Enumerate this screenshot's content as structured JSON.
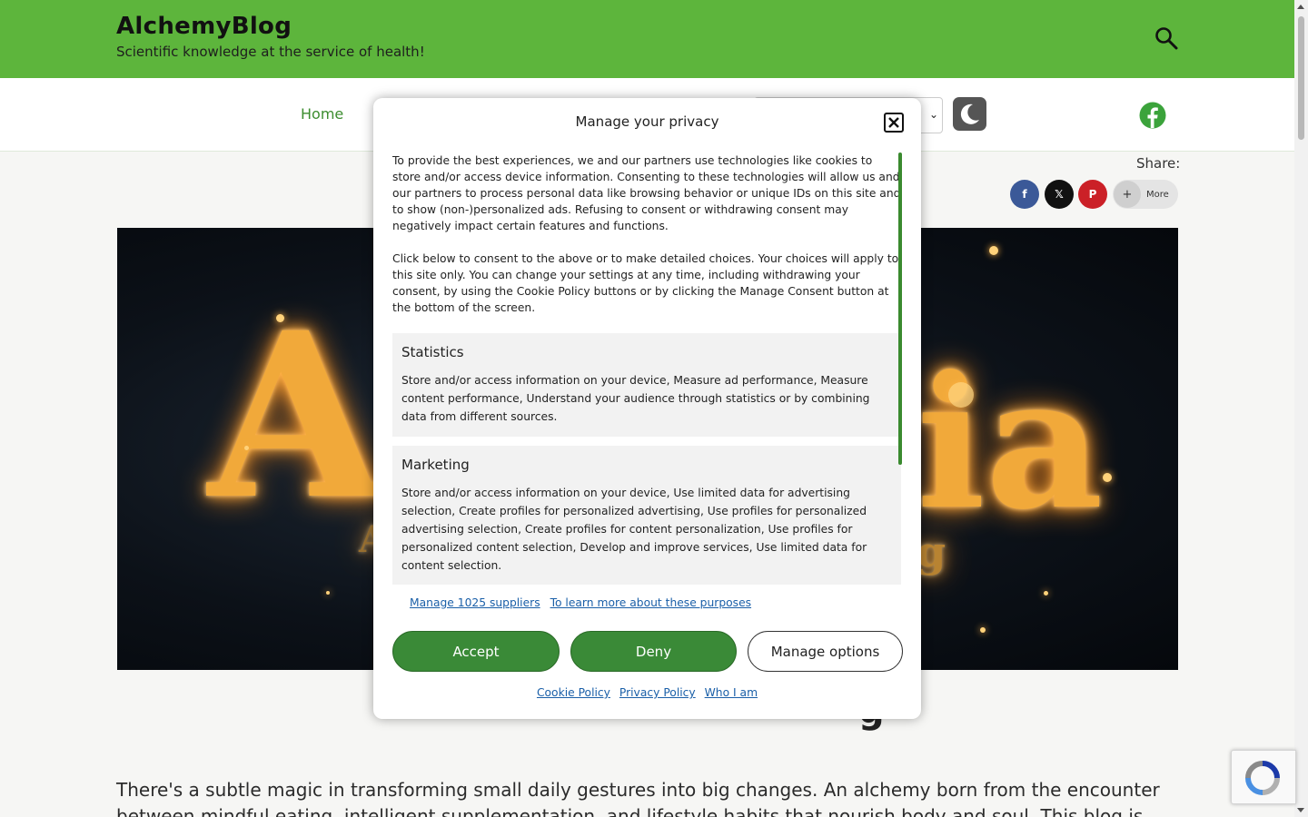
{
  "header": {
    "site_title": "AlchemyBlog",
    "tagline": "Scientific knowledge at the service of health!",
    "search_icon": "search-icon",
    "background_color": "#5db53c"
  },
  "nav": {
    "home_label": "Home",
    "language_select_icon": "chevron-down-icon",
    "dark_mode_icon": "moon-icon",
    "social_icon": "facebook-icon"
  },
  "share": {
    "label": "Share:",
    "facebook": "f",
    "x": "𝕏",
    "pinterest": "P",
    "more_label": "More",
    "more_plus": "+"
  },
  "hero": {
    "letters": [
      "A",
      "ia",
      "A",
      "g"
    ]
  },
  "article": {
    "heading_peek": "g",
    "intro": "There's a subtle magic in transforming small daily gestures into big changes. An alchemy born from the encounter between mindful eating, intelligent supplementation, and lifestyle habits that nourish body and soul. This blog is"
  },
  "consent_modal": {
    "title": "Manage your privacy",
    "close_label": "✕",
    "paragraphs": [
      "To provide the best experiences, we and our partners use technologies like cookies to store and/or access device information. Consenting to these technologies will allow us and our partners to process personal data like browsing behavior or unique IDs on this site and to show (non-)personalized ads. Refusing to consent or withdrawing consent may negatively impact certain features and functions.",
      "Click below to consent to the above or to make detailed choices. Your choices will apply to this site only. You can change your settings at any time, including withdrawing your consent, by using the Cookie Policy buttons or by clicking the Manage Consent button at the bottom of the screen."
    ],
    "purposes": [
      {
        "title": "Statistics",
        "description": "Store and/or access information on your device, Measure ad performance, Measure content performance, Understand your audience through statistics or by combining data from different sources."
      },
      {
        "title": "Marketing",
        "description": "Store and/or access information on your device, Use limited data for advertising selection, Create profiles for personalized advertising, Use profiles for personalized advertising selection, Create profiles for content personalization, Use profiles for personalized content selection, Develop and improve services, Use limited data for content selection."
      }
    ],
    "manage_suppliers_link": "Manage 1025 suppliers",
    "learn_more_link": "To learn more about these purposes",
    "accept_label": "Accept",
    "deny_label": "Deny",
    "manage_options_label": "Manage options",
    "footer_links": [
      "Cookie Policy",
      "Privacy Policy",
      "Who I am"
    ],
    "accent_color": "#3a8a37"
  },
  "recaptcha": {
    "icon": "recaptcha-icon"
  }
}
